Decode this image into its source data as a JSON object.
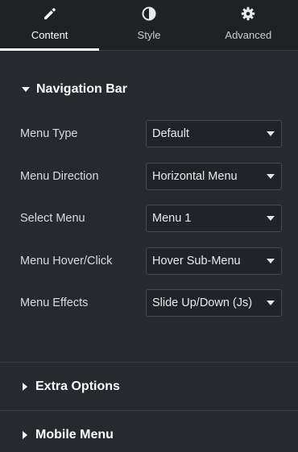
{
  "tabs": [
    {
      "label": "Content",
      "icon": "pencil-icon",
      "active": true
    },
    {
      "label": "Style",
      "icon": "half-circle-icon",
      "active": false
    },
    {
      "label": "Advanced",
      "icon": "gear-icon",
      "active": false
    }
  ],
  "navigation_section": {
    "title": "Navigation Bar",
    "rows": [
      {
        "label": "Menu Type",
        "value": "Default"
      },
      {
        "label": "Menu Direction",
        "value": "Horizontal Menu"
      },
      {
        "label": "Select Menu",
        "value": "Menu 1"
      },
      {
        "label": "Menu Hover/Click",
        "value": "Hover Sub-Menu"
      },
      {
        "label": "Menu Effects",
        "value": "Slide Up/Down (Js)"
      }
    ]
  },
  "collapsed_sections": [
    {
      "title": "Extra Options"
    },
    {
      "title": "Mobile Menu"
    }
  ],
  "colors": {
    "background": "#26292e",
    "tab_bar": "#1f2124",
    "divider": "#3a3d42",
    "active_indicator": "#ffffff"
  }
}
